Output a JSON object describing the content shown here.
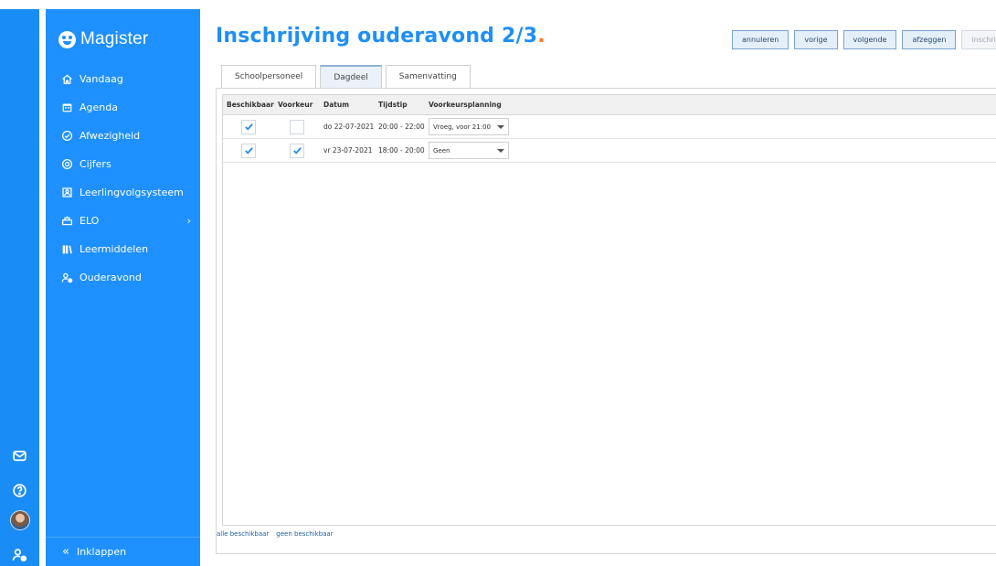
{
  "brand": {
    "name": "Magister"
  },
  "nav": {
    "items": [
      {
        "label": "Vandaag",
        "icon": "home-icon"
      },
      {
        "label": "Agenda",
        "icon": "calendar-icon"
      },
      {
        "label": "Afwezigheid",
        "icon": "check-circle-icon"
      },
      {
        "label": "Cijfers",
        "icon": "grade-icon"
      },
      {
        "label": "Leerlingvolgsysteem",
        "icon": "student-file-icon"
      },
      {
        "label": "ELO",
        "icon": "elo-icon",
        "chevron": "›"
      },
      {
        "label": "Leermiddelen",
        "icon": "books-icon"
      },
      {
        "label": "Ouderavond",
        "icon": "parents-icon"
      }
    ],
    "collapse_label": "Inklappen",
    "collapse_chevron": "«"
  },
  "rail": {
    "icons": [
      "mail-icon",
      "help-icon",
      "avatar",
      "account-settings-icon"
    ]
  },
  "page": {
    "title": "Inschrijving ouderavond 2/3",
    "title_dot": ".",
    "accent": "#1e8ff5",
    "dot_color": "#ff7a1a"
  },
  "toolbar": {
    "buttons": [
      {
        "label": "annuleren",
        "enabled": true
      },
      {
        "label": "vorige",
        "enabled": true
      },
      {
        "label": "volgende",
        "enabled": true
      },
      {
        "label": "afzeggen",
        "enabled": true
      },
      {
        "label": "inschrijven",
        "enabled": false
      }
    ]
  },
  "tabs": [
    {
      "label": "Schoolpersoneel",
      "active": false
    },
    {
      "label": "Dagdeel",
      "active": true
    },
    {
      "label": "Samenvatting",
      "active": false
    }
  ],
  "table": {
    "headers": [
      "Beschikbaar",
      "Voorkeur",
      "Datum",
      "Tijdstip",
      "Voorkeursplanning"
    ],
    "rows": [
      {
        "beschikbaar": true,
        "voorkeur": false,
        "datum": "do 22-07-2021",
        "tijdstip": "20:00 - 22:00",
        "voorkeursplanning": "Vroeg, voor 21:00"
      },
      {
        "beschikbaar": true,
        "voorkeur": true,
        "datum": "vr 23-07-2021",
        "tijdstip": "18:00 - 20:00",
        "voorkeursplanning": "Geen"
      }
    ]
  },
  "footer_links": {
    "all": "alle beschikbaar",
    "none": "geen beschikbaar"
  }
}
